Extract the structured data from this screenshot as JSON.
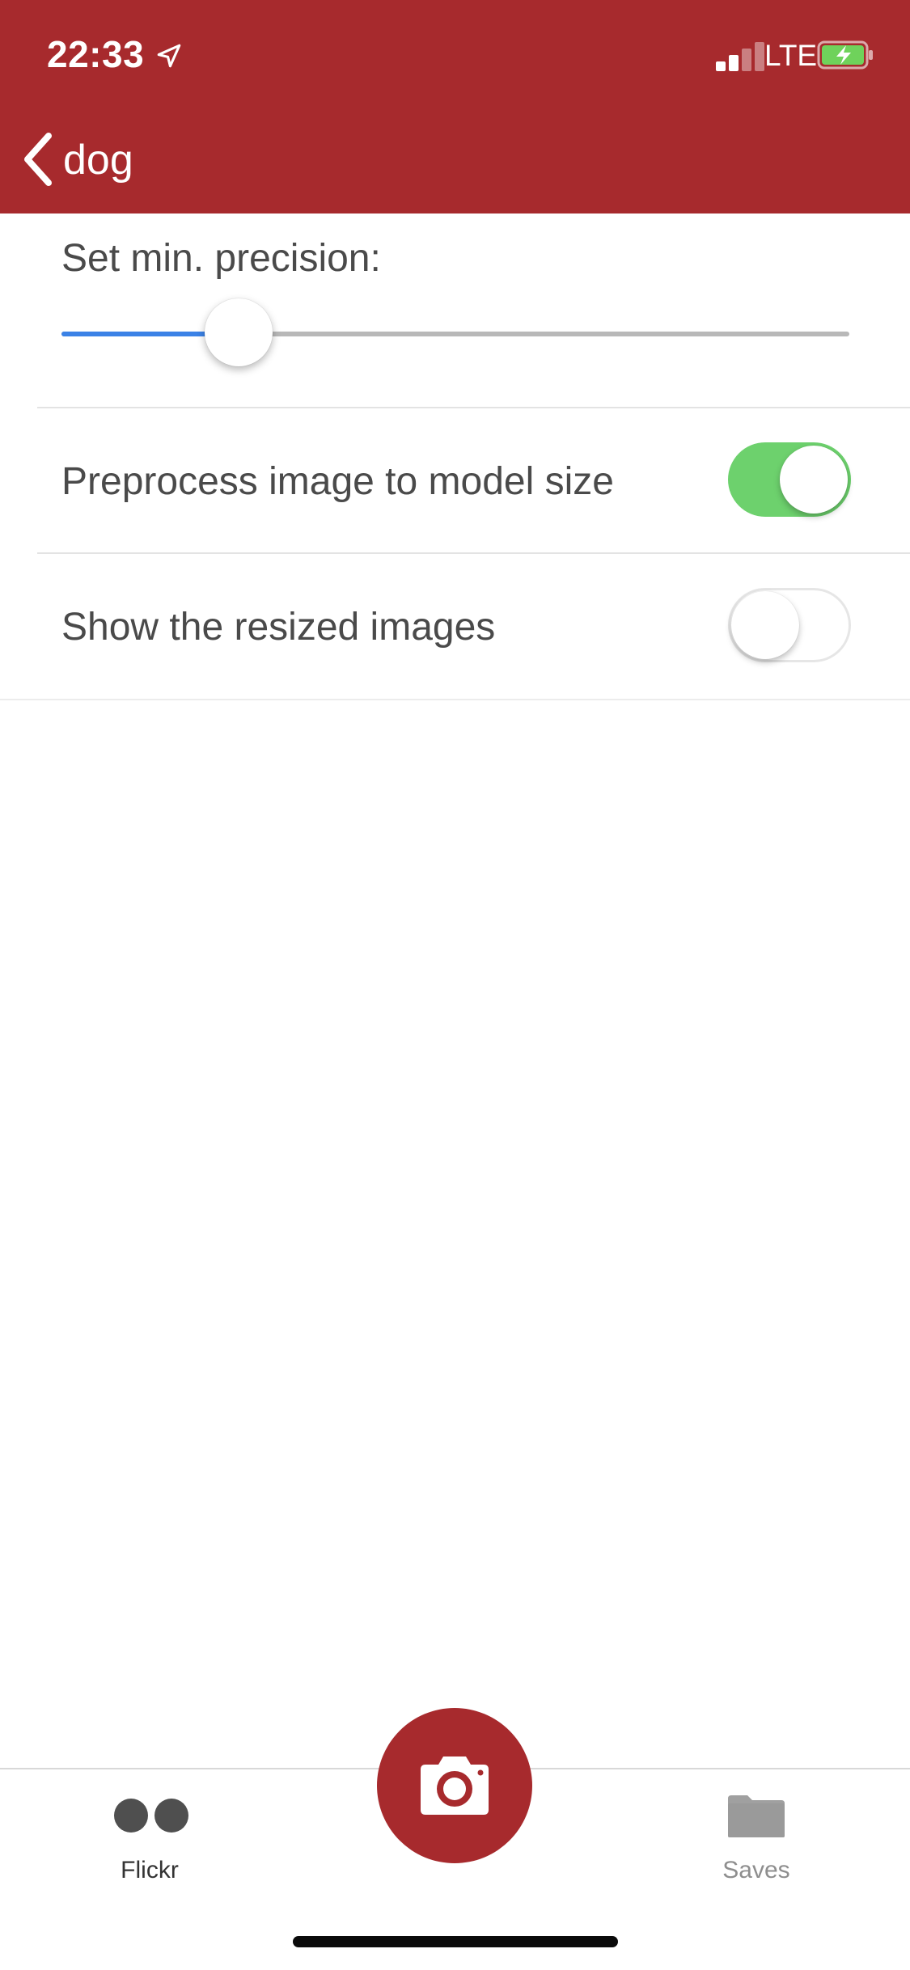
{
  "status_bar": {
    "time": "22:33",
    "network": "LTE",
    "location_icon": "location-arrow-icon",
    "signal_icon": "cellular-signal-icon",
    "battery_icon": "battery-charging-icon"
  },
  "nav": {
    "back_icon": "chevron-left-icon",
    "title": "dog"
  },
  "settings": {
    "precision_label": "Set min. precision:",
    "precision_value": 0.225,
    "preprocess_label": "Preprocess image to model size",
    "preprocess_on": true,
    "show_resized_label": "Show the resized images",
    "show_resized_on": false
  },
  "tabs": [
    {
      "label": "Flickr",
      "icon": "flickr-icon",
      "active": true
    },
    {
      "label": "Saves",
      "icon": "folder-icon",
      "active": false
    }
  ],
  "camera": {
    "icon": "camera-icon"
  },
  "colors": {
    "brand": "#a72a2d",
    "toggle_on": "#6dd16d",
    "slider_fill": "#3b82e6"
  }
}
